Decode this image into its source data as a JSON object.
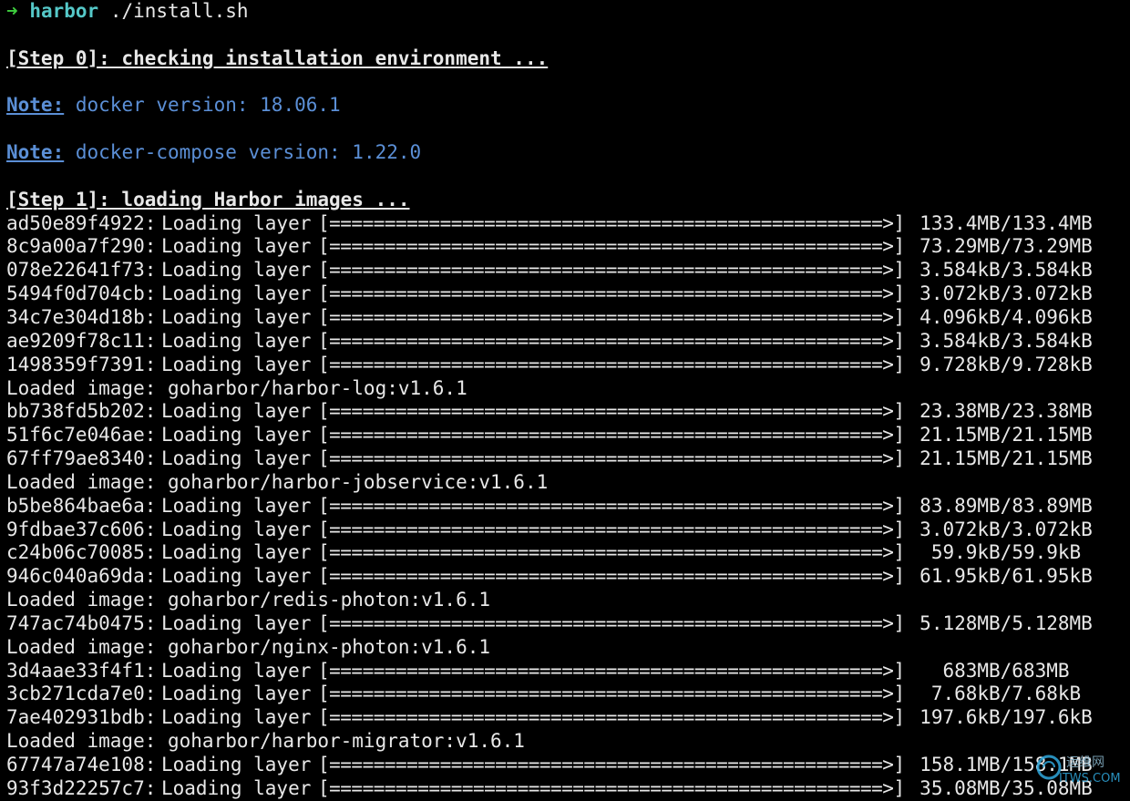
{
  "prompt": {
    "arrow": "➜",
    "dir": "harbor",
    "command": "./install.sh"
  },
  "step0": "[Step 0]: checking installation environment ...",
  "notes": [
    {
      "label": "Note:",
      "text": "docker version: 18.06.1"
    },
    {
      "label": "Note:",
      "text": "docker-compose version: 1.22.0"
    }
  ],
  "step1": "[Step 1]: loading Harbor images ...",
  "bar": "[==================================================>]",
  "status": "Loading layer",
  "lines": [
    {
      "type": "layer",
      "id": "ad50e89f4922:",
      "size": "133.4MB/133.4MB"
    },
    {
      "type": "layer",
      "id": "8c9a00a7f290:",
      "size": "73.29MB/73.29MB"
    },
    {
      "type": "layer",
      "id": "078e22641f73:",
      "size": "3.584kB/3.584kB"
    },
    {
      "type": "layer",
      "id": "5494f0d704cb:",
      "size": "3.072kB/3.072kB"
    },
    {
      "type": "layer",
      "id": "34c7e304d18b:",
      "size": "4.096kB/4.096kB"
    },
    {
      "type": "layer",
      "id": "ae9209f78c11:",
      "size": "3.584kB/3.584kB"
    },
    {
      "type": "layer",
      "id": "1498359f7391:",
      "size": "9.728kB/9.728kB"
    },
    {
      "type": "image",
      "text": "Loaded image: goharbor/harbor-log:v1.6.1"
    },
    {
      "type": "layer",
      "id": "bb738fd5b202:",
      "size": "23.38MB/23.38MB"
    },
    {
      "type": "layer",
      "id": "51f6c7e046ae:",
      "size": "21.15MB/21.15MB"
    },
    {
      "type": "layer",
      "id": "67ff79ae8340:",
      "size": "21.15MB/21.15MB"
    },
    {
      "type": "image",
      "text": "Loaded image: goharbor/harbor-jobservice:v1.6.1"
    },
    {
      "type": "layer",
      "id": "b5be864bae6a:",
      "size": "83.89MB/83.89MB"
    },
    {
      "type": "layer",
      "id": "9fdbae37c606:",
      "size": "3.072kB/3.072kB"
    },
    {
      "type": "layer",
      "id": "c24b06c70085:",
      "size": "59.9kB/59.9kB"
    },
    {
      "type": "layer",
      "id": "946c040a69da:",
      "size": "61.95kB/61.95kB"
    },
    {
      "type": "image",
      "text": "Loaded image: goharbor/redis-photon:v1.6.1"
    },
    {
      "type": "layer",
      "id": "747ac74b0475:",
      "size": "5.128MB/5.128MB"
    },
    {
      "type": "image",
      "text": "Loaded image: goharbor/nginx-photon:v1.6.1"
    },
    {
      "type": "layer",
      "id": "3d4aae33f4f1:",
      "size": "683MB/683MB"
    },
    {
      "type": "layer",
      "id": "3cb271cda7e0:",
      "size": "7.68kB/7.68kB"
    },
    {
      "type": "layer",
      "id": "7ae402931bdb:",
      "size": "197.6kB/197.6kB"
    },
    {
      "type": "image",
      "text": "Loaded image: goharbor/harbor-migrator:v1.6.1"
    },
    {
      "type": "layer",
      "id": "67747a74e108:",
      "size": "158.1MB/158.1MB"
    },
    {
      "type": "layer",
      "id": "93f3d22257c7:",
      "size": "35.08MB/35.08MB"
    }
  ],
  "watermark": {
    "text": "运维网",
    "sub": "ITWS.COM"
  },
  "colors": {
    "background": "#000000",
    "foreground": "#e8e8e8",
    "note": "#5b8fd6",
    "prompt_arrow": "#3ecf3e",
    "prompt_dir": "#55c8c8"
  }
}
